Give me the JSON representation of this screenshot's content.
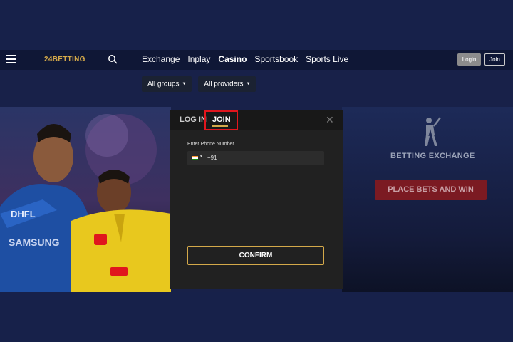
{
  "header": {
    "logo": "24BETTING",
    "nav": [
      "Exchange",
      "Inplay",
      "Casino",
      "Sportsbook",
      "Sports Live"
    ],
    "active_nav": "Casino",
    "login_label": "Login",
    "join_label": "Join"
  },
  "filters": {
    "groups_label": "All groups",
    "providers_label": "All providers"
  },
  "hero": {
    "sponsor_text": "DHFL",
    "shirt_text": "SAMSUNG"
  },
  "side_promo": {
    "title": "BETTING EXCHANGE",
    "cta": "PLACE BETS AND WIN"
  },
  "modal": {
    "tab_login": "LOG IN",
    "tab_join": "JOIN",
    "active_tab": "JOIN",
    "phone_label": "Enter Phone Number",
    "country_code": "+91",
    "confirm_label": "CONFIRM"
  },
  "colors": {
    "accent_gold": "#d4a94a",
    "highlight_red": "#e0161d",
    "cta_red": "#7b1a22"
  },
  "icons": [
    "hamburger-icon",
    "search-icon",
    "close-icon",
    "india-flag-icon",
    "cricket-batsman-icon"
  ]
}
